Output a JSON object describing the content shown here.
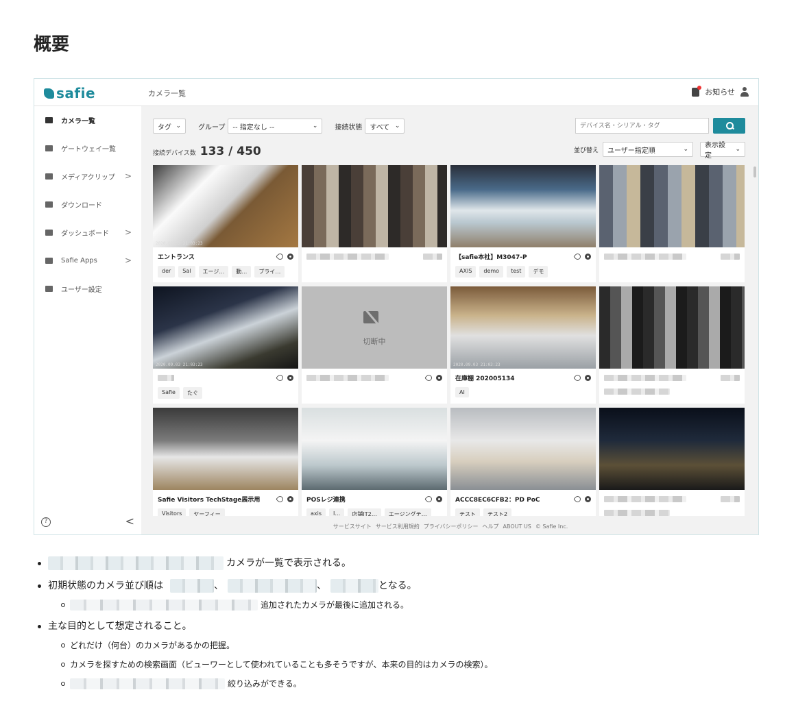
{
  "page": {
    "heading": "概要"
  },
  "app": {
    "logo_text": "safie",
    "header_title": "カメラ一覧",
    "notifications_label": "お知らせ",
    "sidebar": [
      {
        "label": "カメラ一覧",
        "icon": "video-camera-icon",
        "active": true,
        "chevron": ""
      },
      {
        "label": "ゲートウェイ一覧",
        "icon": "gateway-icon",
        "active": false,
        "chevron": ""
      },
      {
        "label": "メディアクリップ",
        "icon": "film-icon",
        "active": false,
        "chevron": ">"
      },
      {
        "label": "ダウンロード",
        "icon": "download-icon",
        "active": false,
        "chevron": ""
      },
      {
        "label": "ダッシュボード",
        "icon": "dashboard-icon",
        "active": false,
        "chevron": ">"
      },
      {
        "label": "Safie Apps",
        "icon": "apps-icon",
        "active": false,
        "chevron": ">"
      },
      {
        "label": "ユーザー設定",
        "icon": "user-settings-icon",
        "active": false,
        "chevron": ""
      }
    ],
    "help_glyph": "?",
    "collapse_glyph": "<",
    "filters": {
      "tag_label": "タグ",
      "group_label": "グループ",
      "group_value": "-- 指定なし --",
      "status_label": "接続状態",
      "status_value": "すべて",
      "search_placeholder": "デバイス名・シリアル・タグ"
    },
    "count": {
      "label": "接続デバイス数",
      "value": "133 / 450"
    },
    "sort": {
      "label": "並び替え",
      "value": "ユーザー指定順",
      "display_settings": "表示設定"
    },
    "cameras": [
      {
        "title": "エントランス",
        "tags": [
          "der",
          "Sal",
          "エージ…",
          "動…",
          "プライ…"
        ],
        "timestamp": "2020.09.03 21:03:23",
        "offline": false,
        "blurred_title": false
      },
      {
        "title": "",
        "tags": [],
        "timestamp": "",
        "offline": false,
        "blurred_title": true
      },
      {
        "title": "【safie本社】M3047-P",
        "tags": [
          "AXIS",
          "demo",
          "test",
          "デモ"
        ],
        "timestamp": "",
        "offline": false,
        "blurred_title": false
      },
      {
        "title": "",
        "tags": [],
        "timestamp": "",
        "offline": false,
        "blurred_title": true
      },
      {
        "title": "",
        "tags": [
          "Safie",
          "たぐ"
        ],
        "timestamp": "2020.09.03 21:03:23",
        "offline": false,
        "blurred_title": true
      },
      {
        "title": "",
        "tags": [],
        "timestamp": "",
        "offline": true,
        "offline_label": "切断中",
        "blurred_title": true
      },
      {
        "title": "在庫棚 202005134",
        "tags": [
          "AI"
        ],
        "timestamp": "2020.09.03 21:03:23",
        "offline": false,
        "blurred_title": false
      },
      {
        "title": "",
        "tags": [],
        "timestamp": "",
        "offline": false,
        "blurred_title": true
      },
      {
        "title": "Safie Visitors TechStage展示用",
        "tags": [
          "Visitors",
          "ヤーフィー"
        ],
        "timestamp": "",
        "offline": false,
        "blurred_title": false
      },
      {
        "title": "POSレジ連携",
        "tags": [
          "axis",
          "I…",
          "店舗IT2…",
          "エージングテ…"
        ],
        "timestamp": "",
        "offline": false,
        "blurred_title": false
      },
      {
        "title": "ACCC8EC6CFB2：PD PoC",
        "tags": [
          "テスト",
          "テスト2"
        ],
        "timestamp": "",
        "offline": false,
        "blurred_title": false
      },
      {
        "title": "",
        "tags": [],
        "timestamp": "",
        "offline": false,
        "blurred_title": true
      }
    ],
    "footer_links": [
      "サービスサイト",
      "サービス利用規約",
      "プライバシーポリシー",
      "ヘルプ",
      "ABOUT US",
      "© Safie Inc."
    ]
  },
  "notes": {
    "item1": "カメラが一覧で表示される。",
    "item2_prefix": "初期状態のカメラ並び順は",
    "item2_sep1": "、",
    "item2_sep2": "、",
    "item2_suffix": "となる。",
    "item2_sub": "追加されたカメラが最後に追加される。",
    "item3": "主な目的として想定されること。",
    "item3_sub1": "どれだけ（何台）のカメラがあるかの把握。",
    "item3_sub2": "カメラを探すための検索画面（ビューワーとして使われていることも多そうですが、本来の目的はカメラの検索）。",
    "item3_sub3": "絞り込みができる。"
  }
}
